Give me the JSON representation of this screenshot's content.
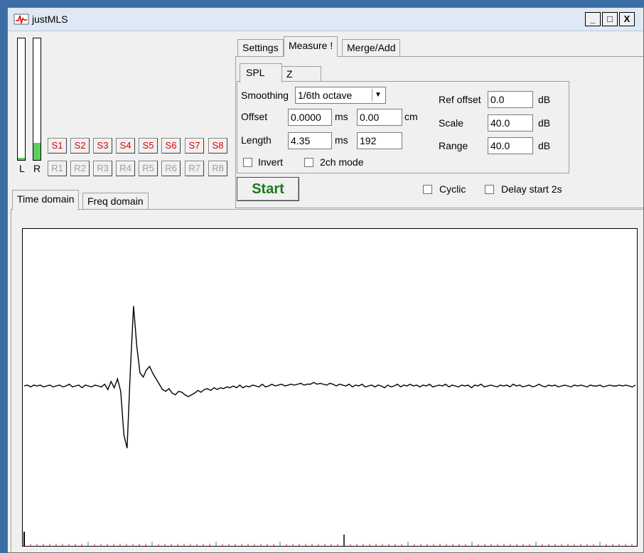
{
  "window": {
    "title": "justMLS",
    "minimize": "_",
    "maximize": "□",
    "close": "X"
  },
  "meters": {
    "left_label": "L",
    "right_label": "R",
    "left_level": 0.02,
    "right_level": 0.14
  },
  "slots": {
    "s": [
      "S1",
      "S2",
      "S3",
      "S4",
      "S5",
      "S6",
      "S7",
      "S8"
    ],
    "r": [
      "R1",
      "R2",
      "R3",
      "R4",
      "R5",
      "R6",
      "R7",
      "R8"
    ]
  },
  "view_tabs": [
    "Time domain",
    "Freq domain"
  ],
  "main_tabs": [
    "Settings",
    "Measure !",
    "Merge/Add"
  ],
  "sub_tabs": [
    "SPL",
    "Z"
  ],
  "measure": {
    "smoothing_label": "Smoothing",
    "smoothing_value": "1/6th octave",
    "offset_label": "Offset",
    "offset_ms": "0.0000",
    "offset_ms_unit": "ms",
    "offset_cm": "0.00",
    "offset_cm_unit": "cm",
    "length_label": "Length",
    "length_ms": "4.35",
    "length_ms_unit": "ms",
    "length_samples": "192",
    "invert_label": "Invert",
    "twoch_label": "2ch mode",
    "ref_offset_label": "Ref offset",
    "ref_offset_value": "0.0",
    "scale_label": "Scale",
    "scale_value": "40.0",
    "range_label": "Range",
    "range_value": "40.0",
    "db_unit": "dB"
  },
  "controls": {
    "start_label": "Start",
    "cyclic_label": "Cyclic",
    "delay_label": "Delay start 2s"
  },
  "colors": {
    "trace": "#000000",
    "accent_green": "#1a7a1a",
    "slot_red": "#e00000",
    "meter_green": "#5ccf5c"
  },
  "chart_data": {
    "type": "line",
    "title": "",
    "xlabel": "",
    "ylabel": "",
    "ylim": [
      -1,
      1
    ],
    "x_range": [
      0,
      192
    ],
    "series": [
      {
        "values": [
          0,
          0.01,
          -0.01,
          0.01,
          0,
          0.01,
          -0.01,
          0,
          0.01,
          -0.01,
          0,
          0.01,
          -0.01,
          0,
          0.02,
          -0.01,
          0,
          0.01,
          -0.02,
          0.01,
          0,
          -0.01,
          0.01,
          0,
          -0.01,
          0.02,
          -0.04,
          0.05,
          -0.02,
          0.08,
          -0.06,
          -0.55,
          -0.7,
          0.18,
          0.9,
          0.45,
          0.15,
          0.1,
          0.18,
          0.22,
          0.14,
          0.08,
          0.02,
          -0.04,
          -0.06,
          -0.03,
          -0.08,
          -0.1,
          -0.06,
          -0.07,
          -0.1,
          -0.12,
          -0.1,
          -0.08,
          -0.05,
          -0.07,
          -0.04,
          -0.03,
          -0.05,
          -0.02,
          -0.04,
          -0.02,
          -0.03,
          -0.01,
          -0.02,
          0,
          -0.02,
          0.01,
          -0.02,
          0,
          -0.01,
          0.01,
          0,
          -0.01,
          0.02,
          -0.01,
          0,
          0.02,
          0,
          0.01,
          0.02,
          0,
          0.01,
          0.02,
          0.01,
          0.02,
          0.03,
          0.01,
          0.02,
          0.02,
          0.04,
          0.02,
          0.03,
          0.02,
          0.01,
          0.03,
          0.02,
          0,
          0.02,
          0.01,
          0,
          0.02,
          -0.01,
          0.01,
          0,
          0.02,
          -0.01,
          0,
          0.01,
          -0.01,
          0.01,
          0,
          -0.02,
          0.01,
          -0.01,
          0,
          0.02,
          -0.01,
          0.01,
          0,
          0.02,
          0,
          0.01,
          -0.01,
          0.01,
          0,
          0.02,
          -0.01,
          0,
          0.01,
          0,
          0.02,
          -0.01,
          0.01,
          0,
          -0.01,
          0.01,
          0,
          0.01,
          -0.02,
          0.01,
          0,
          0.02,
          -0.01,
          0,
          0.01,
          0,
          -0.01,
          0.01,
          0,
          0.01,
          -0.01,
          0.02,
          0,
          0.01,
          -0.01,
          0,
          0.01,
          -0.01,
          0,
          0.02,
          0,
          -0.01,
          0.01,
          0,
          0.01,
          -0.01,
          0,
          0.01,
          0,
          -0.01,
          0.01,
          0,
          0.01,
          0,
          -0.01,
          0.01,
          0,
          0,
          0.01,
          -0.01,
          0,
          0.01,
          0,
          0,
          0.01,
          0,
          0.01,
          0,
          -0.01,
          0.01
        ]
      }
    ]
  }
}
